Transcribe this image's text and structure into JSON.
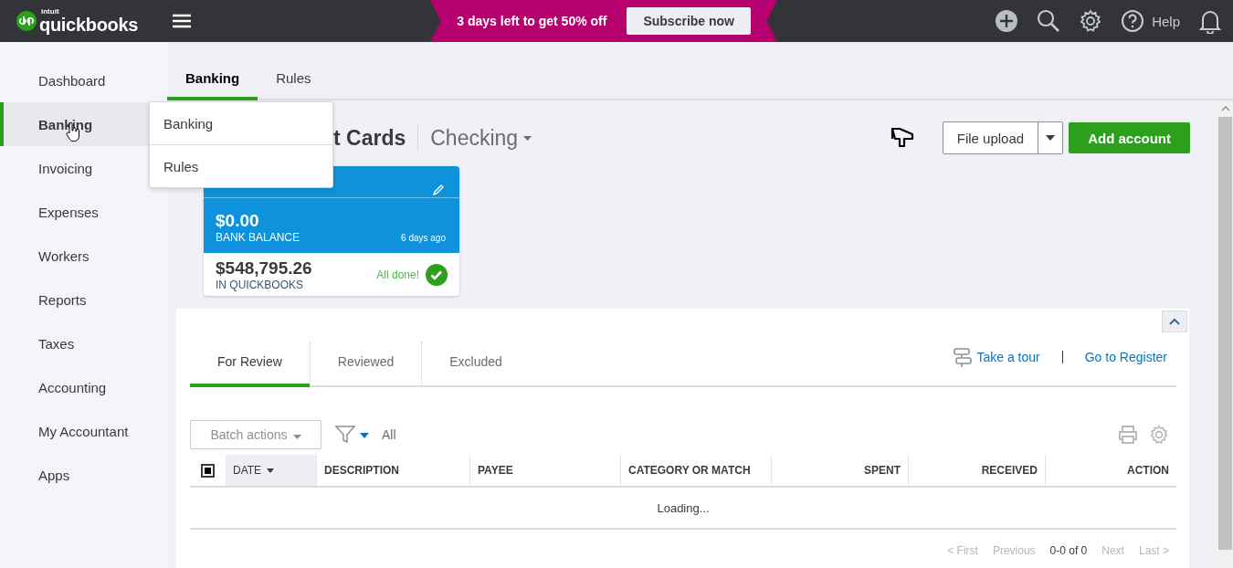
{
  "header": {
    "logo_small": "intuit",
    "logo": "quickbooks",
    "promo": "3 days left to get 50% off",
    "subscribe": "Subscribe now",
    "help": "Help"
  },
  "sidebar": {
    "items": [
      {
        "label": "Dashboard",
        "selected": false
      },
      {
        "label": "Banking",
        "selected": true
      },
      {
        "label": "Invoicing",
        "selected": false
      },
      {
        "label": "Expenses",
        "selected": false
      },
      {
        "label": "Workers",
        "selected": false
      },
      {
        "label": "Reports",
        "selected": false
      },
      {
        "label": "Taxes",
        "selected": false
      },
      {
        "label": "Accounting",
        "selected": false
      },
      {
        "label": "My Accountant",
        "selected": false
      },
      {
        "label": "Apps",
        "selected": false
      }
    ]
  },
  "subtabs": [
    {
      "label": "Banking",
      "selected": true
    },
    {
      "label": "Rules",
      "selected": false
    }
  ],
  "menu": {
    "items": [
      "Banking",
      "Rules"
    ]
  },
  "page": {
    "title": "t Cards",
    "account": "Checking",
    "file_upload": "File upload",
    "add_account": "Add account"
  },
  "account_card": {
    "bank_balance": "$0.00",
    "bank_balance_label": "BANK BALANCE",
    "updated": "6 days ago",
    "qb_balance": "$548,795.26",
    "qb_label": "IN QUICKBOOKS",
    "status": "All done!"
  },
  "review_tabs": [
    {
      "label": "For Review",
      "selected": true
    },
    {
      "label": "Reviewed",
      "selected": false
    },
    {
      "label": "Excluded",
      "selected": false
    }
  ],
  "links": {
    "tour": "Take a tour",
    "register": "Go to Register"
  },
  "toolbar": {
    "batch": "Batch actions",
    "filter": "All"
  },
  "table": {
    "select_all": {
      "checked": true
    },
    "columns": [
      {
        "label": "DATE",
        "sorted": true
      },
      {
        "label": "DESCRIPTION",
        "sorted": false
      },
      {
        "label": "PAYEE",
        "sorted": false
      },
      {
        "label": "CATEGORY OR MATCH",
        "sorted": false
      },
      {
        "label": "SPENT",
        "sorted": false
      },
      {
        "label": "RECEIVED",
        "sorted": false
      },
      {
        "label": "ACTION",
        "sorted": false
      }
    ],
    "status": "Loading..."
  },
  "pagination": [
    {
      "label": "< First",
      "disabled": true
    },
    {
      "label": "Previous",
      "disabled": true
    },
    {
      "label": "0-0 of 0",
      "disabled": false
    },
    {
      "label": "Next",
      "disabled": true
    },
    {
      "label": "Last >",
      "disabled": true
    }
  ]
}
